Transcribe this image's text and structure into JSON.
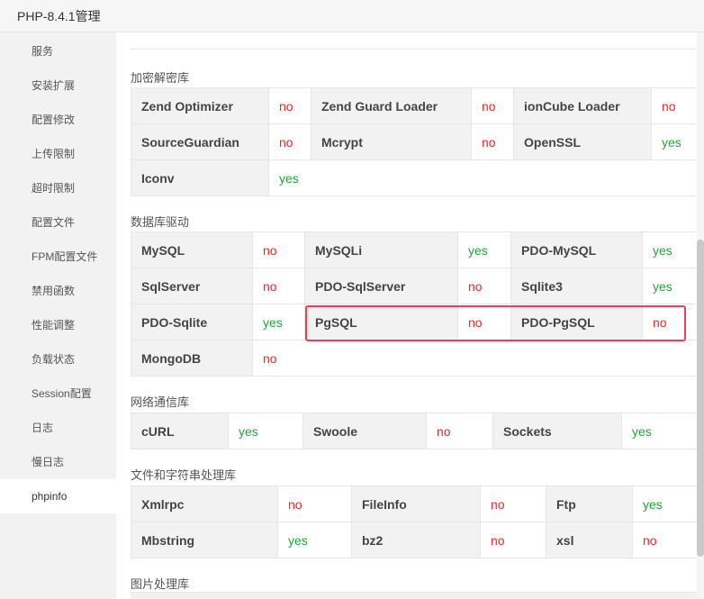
{
  "window": {
    "title": "PHP-8.4.1管理"
  },
  "sidebar": {
    "items": [
      {
        "label": "服务"
      },
      {
        "label": "安装扩展"
      },
      {
        "label": "配置修改"
      },
      {
        "label": "上传限制"
      },
      {
        "label": "超时限制"
      },
      {
        "label": "配置文件"
      },
      {
        "label": "FPM配置文件"
      },
      {
        "label": "禁用函数"
      },
      {
        "label": "性能调整"
      },
      {
        "label": "负载状态"
      },
      {
        "label": "Session配置"
      },
      {
        "label": "日志"
      },
      {
        "label": "慢日志"
      },
      {
        "label": "phpinfo",
        "active": true
      }
    ]
  },
  "sections": {
    "encryption": {
      "title": "加密解密库",
      "rows": [
        [
          {
            "name": "Zend Optimizer",
            "value": "no"
          },
          {
            "name": "Zend Guard Loader",
            "value": "no"
          },
          {
            "name": "ionCube Loader",
            "value": "no"
          }
        ],
        [
          {
            "name": "SourceGuardian",
            "value": "no"
          },
          {
            "name": "Mcrypt",
            "value": "no"
          },
          {
            "name": "OpenSSL",
            "value": "yes"
          }
        ],
        [
          {
            "name": "Iconv",
            "value": "yes"
          }
        ]
      ]
    },
    "database": {
      "title": "数据库驱动",
      "rows": [
        [
          {
            "name": "MySQL",
            "value": "no"
          },
          {
            "name": "MySQLi",
            "value": "yes"
          },
          {
            "name": "PDO-MySQL",
            "value": "yes"
          }
        ],
        [
          {
            "name": "SqlServer",
            "value": "no"
          },
          {
            "name": "PDO-SqlServer",
            "value": "no"
          },
          {
            "name": "Sqlite3",
            "value": "yes"
          }
        ],
        [
          {
            "name": "PDO-Sqlite",
            "value": "yes"
          },
          {
            "name": "PgSQL",
            "value": "no"
          },
          {
            "name": "PDO-PgSQL",
            "value": "no"
          }
        ],
        [
          {
            "name": "MongoDB",
            "value": "no"
          }
        ]
      ]
    },
    "network": {
      "title": "网络通信库",
      "rows": [
        [
          {
            "name": "cURL",
            "value": "yes"
          },
          {
            "name": "Swoole",
            "value": "no"
          },
          {
            "name": "Sockets",
            "value": "yes"
          }
        ]
      ]
    },
    "strings": {
      "title": "文件和字符串处理库",
      "rows": [
        [
          {
            "name": "Xmlrpc",
            "value": "no"
          },
          {
            "name": "FileInfo",
            "value": "no"
          },
          {
            "name": "Ftp",
            "value": "yes"
          }
        ],
        [
          {
            "name": "Mbstring",
            "value": "yes"
          },
          {
            "name": "bz2",
            "value": "no"
          },
          {
            "name": "xsl",
            "value": "no"
          }
        ]
      ]
    },
    "image": {
      "title": "图片处理库"
    }
  },
  "colors": {
    "yes": "#20a53a",
    "no": "#e22b2b",
    "highlight": "#e8425a"
  }
}
